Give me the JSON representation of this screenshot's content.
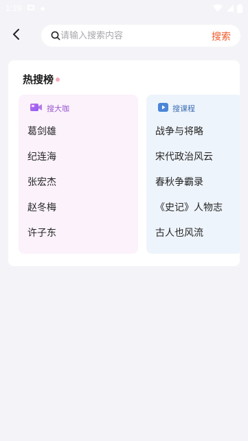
{
  "status": {
    "time": "1:19"
  },
  "search": {
    "placeholder": "请输入搜索内容",
    "value": "",
    "button_label": "搜索"
  },
  "hot": {
    "title": "热搜榜",
    "panels": [
      {
        "label": "搜大咖",
        "icon": "video-camera-icon",
        "items": [
          "葛剑雄",
          "纪连海",
          "张宏杰",
          "赵冬梅",
          "许子东"
        ]
      },
      {
        "label": "搜课程",
        "icon": "play-icon",
        "items": [
          "战争与将略",
          "宋代政治风云",
          "春秋争霸录",
          "《史记》人物志",
          "古人也风流"
        ]
      }
    ]
  },
  "colors": {
    "accent": "#ef5a2a",
    "panel1_bg": "#fbf2fb",
    "panel2_bg": "#eef4fb",
    "panel1_text": "#9a5bd0",
    "panel2_text": "#3d6fb5"
  }
}
